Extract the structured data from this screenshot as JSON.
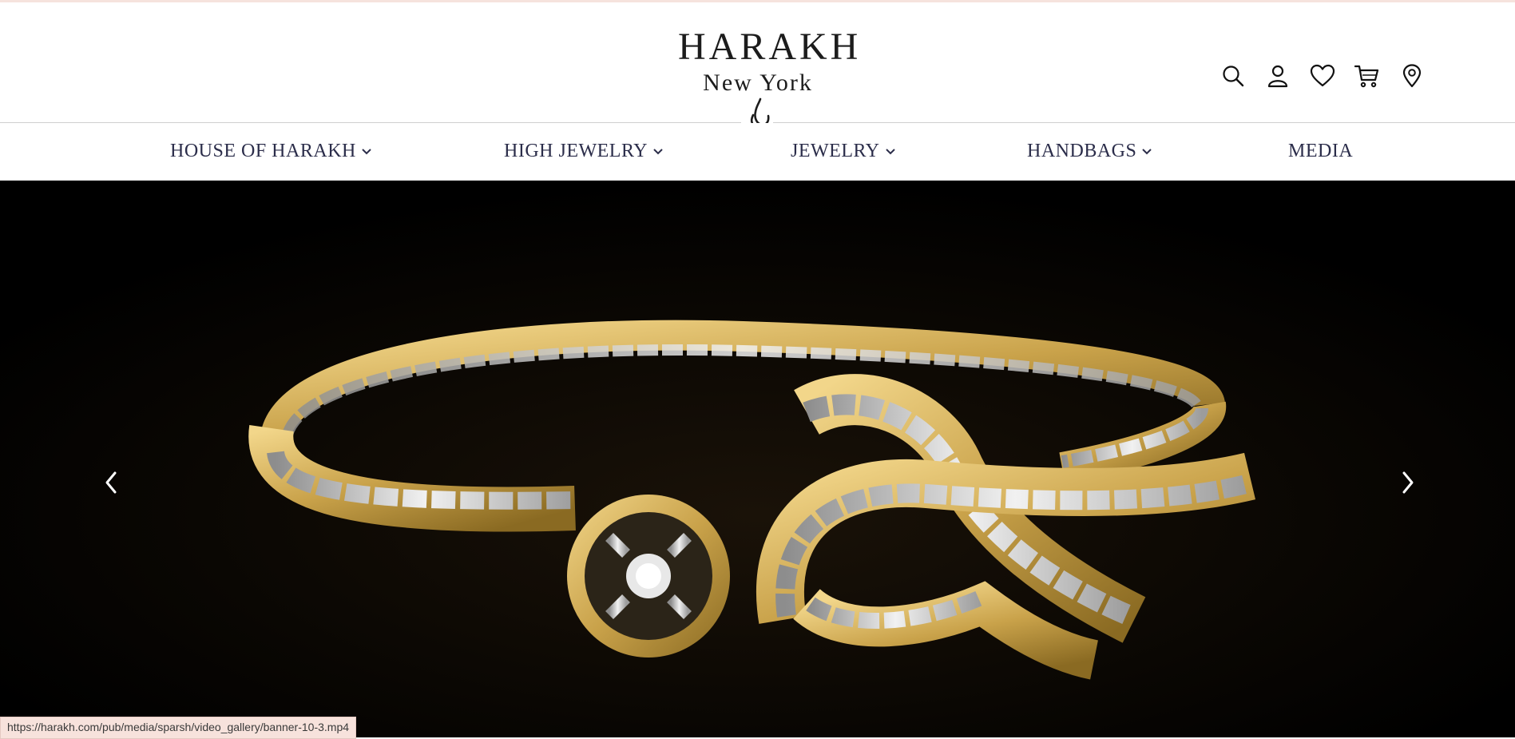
{
  "brand": {
    "name": "HARAKH",
    "city": "New York"
  },
  "header_icons": [
    "search-icon",
    "account-icon",
    "wishlist-heart-icon",
    "cart-icon",
    "store-locator-icon"
  ],
  "nav": {
    "items": [
      {
        "label": "HOUSE OF HARAKH",
        "has_dropdown": true
      },
      {
        "label": "HIGH JEWELRY",
        "has_dropdown": true
      },
      {
        "label": "JEWELRY",
        "has_dropdown": true
      },
      {
        "label": "HANDBAGS",
        "has_dropdown": true
      },
      {
        "label": "MEDIA",
        "has_dropdown": false
      }
    ]
  },
  "hero": {
    "media": "gold diamond bow cuff bracelet",
    "prev_icon": "chevron-left-icon",
    "next_icon": "chevron-right-icon"
  },
  "status_bar": {
    "url": "https://harakh.com/pub/media/sparsh/video_gallery/banner-10-3.mp4"
  },
  "colors": {
    "nav_text": "#2b2d4a",
    "status_bg": "#f7e2dc",
    "gold": "#c9a24a",
    "hero_bg": "#000000"
  }
}
